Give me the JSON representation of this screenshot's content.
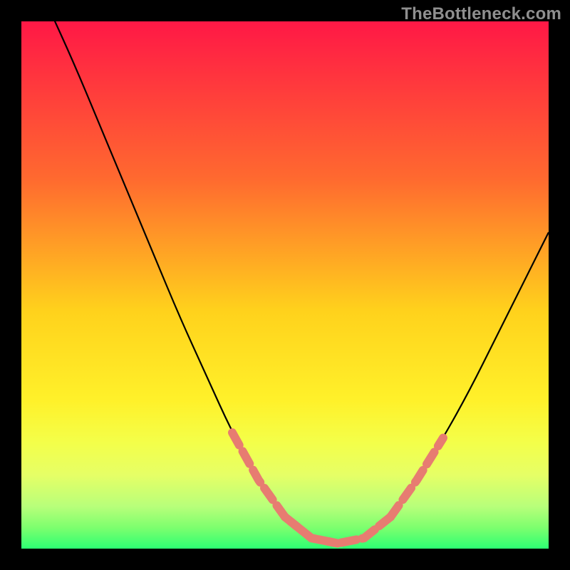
{
  "watermark": "TheBottleneck.com",
  "chart_data": {
    "type": "line",
    "title": "",
    "xlabel": "",
    "ylabel": "",
    "xlim": [
      0,
      100
    ],
    "ylim": [
      0,
      100
    ],
    "grid": false,
    "legend": false,
    "gradient_stops": [
      {
        "offset": 0,
        "color": "#ff1846"
      },
      {
        "offset": 30,
        "color": "#ff6a2f"
      },
      {
        "offset": 55,
        "color": "#ffd21c"
      },
      {
        "offset": 72,
        "color": "#fff12a"
      },
      {
        "offset": 80,
        "color": "#f3ff4a"
      },
      {
        "offset": 86,
        "color": "#e6ff66"
      },
      {
        "offset": 92,
        "color": "#b8ff7a"
      },
      {
        "offset": 96,
        "color": "#7dff6e"
      },
      {
        "offset": 100,
        "color": "#2dff73"
      }
    ],
    "series": [
      {
        "name": "bottleneck-curve",
        "stroke": "#000000",
        "stroke_width": 2.2,
        "points": [
          {
            "x": 5,
            "y": 103
          },
          {
            "x": 10,
            "y": 92
          },
          {
            "x": 15,
            "y": 80
          },
          {
            "x": 20,
            "y": 68
          },
          {
            "x": 25,
            "y": 56
          },
          {
            "x": 30,
            "y": 44
          },
          {
            "x": 35,
            "y": 33
          },
          {
            "x": 40,
            "y": 22
          },
          {
            "x": 45,
            "y": 13
          },
          {
            "x": 50,
            "y": 6
          },
          {
            "x": 55,
            "y": 2
          },
          {
            "x": 60,
            "y": 1
          },
          {
            "x": 65,
            "y": 2
          },
          {
            "x": 70,
            "y": 6
          },
          {
            "x": 75,
            "y": 13
          },
          {
            "x": 80,
            "y": 21
          },
          {
            "x": 85,
            "y": 30
          },
          {
            "x": 90,
            "y": 40
          },
          {
            "x": 95,
            "y": 50
          },
          {
            "x": 100,
            "y": 60
          }
        ]
      },
      {
        "name": "highlight-left",
        "stroke": "#e77c71",
        "stroke_width": 12,
        "dash": [
          20,
          10
        ],
        "points": [
          {
            "x": 40,
            "y": 22
          },
          {
            "x": 45,
            "y": 13
          },
          {
            "x": 50,
            "y": 6
          },
          {
            "x": 55,
            "y": 2
          },
          {
            "x": 60,
            "y": 1
          }
        ]
      },
      {
        "name": "highlight-bottom",
        "stroke": "#e77c71",
        "stroke_width": 12,
        "dash": [
          22,
          8
        ],
        "points": [
          {
            "x": 50,
            "y": 6
          },
          {
            "x": 55,
            "y": 2
          },
          {
            "x": 60,
            "y": 1
          },
          {
            "x": 65,
            "y": 2
          },
          {
            "x": 70,
            "y": 6
          }
        ]
      },
      {
        "name": "highlight-right",
        "stroke": "#e77c71",
        "stroke_width": 12,
        "dash": [
          20,
          10
        ],
        "points": [
          {
            "x": 70,
            "y": 6
          },
          {
            "x": 75,
            "y": 13
          },
          {
            "x": 80,
            "y": 21
          }
        ]
      }
    ]
  }
}
